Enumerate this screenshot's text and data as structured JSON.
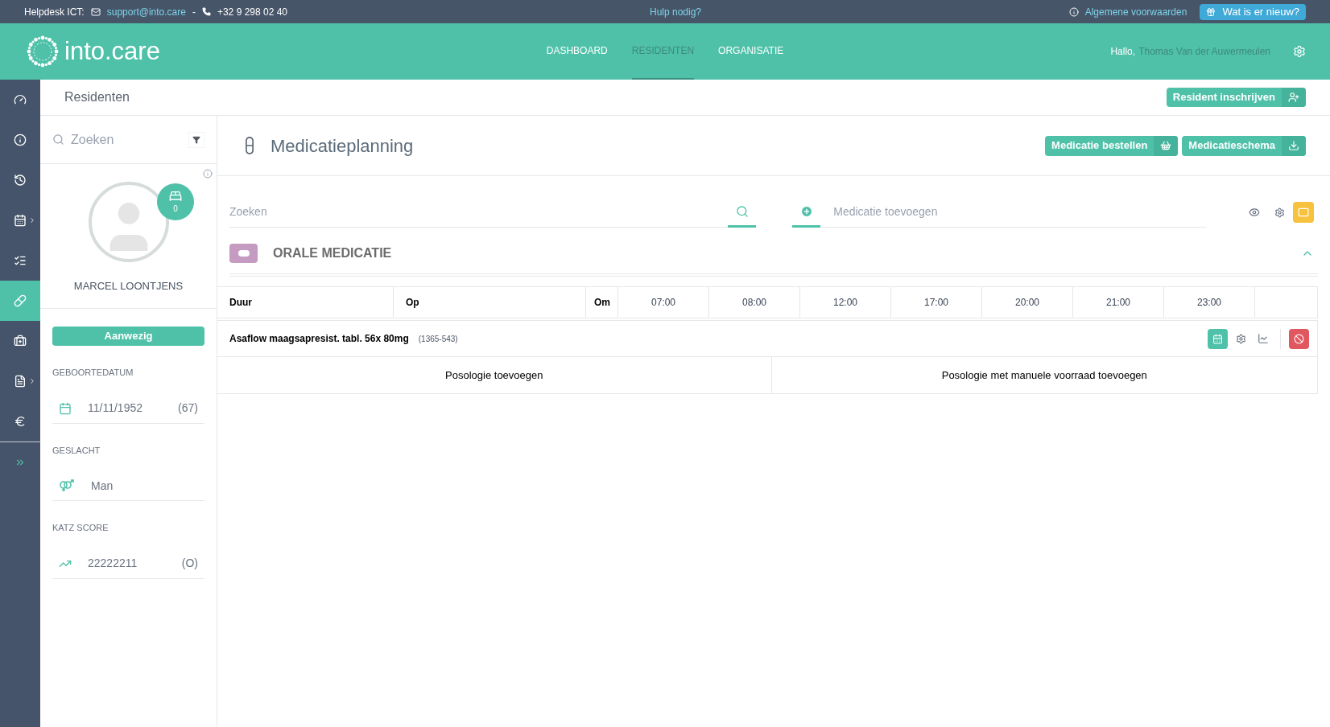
{
  "top_bar": {
    "helpdesk_label": "Helpdesk ICT:",
    "email": "support@into.care",
    "separator": "-",
    "phone": "+32 9 298 02 40",
    "help_link": "Hulp nodig?",
    "terms_link": "Algemene voorwaarden",
    "whats_new_button": "Wat is er nieuw?"
  },
  "nav": {
    "logo_text": "into.care",
    "items": [
      {
        "label": "DASHBOARD",
        "selected": false
      },
      {
        "label": "RESIDENTEN",
        "selected": true
      },
      {
        "label": "ORGANISATIE",
        "selected": false
      }
    ],
    "greeting": "Hallo,",
    "user_name": "Thomas Van der Auwermeulen"
  },
  "rail": {
    "items": [
      {
        "kind": "dashboard",
        "selected": false,
        "submenu": false
      },
      {
        "kind": "info",
        "selected": false,
        "submenu": false
      },
      {
        "kind": "history",
        "selected": false,
        "submenu": false
      },
      {
        "kind": "calendar",
        "selected": false,
        "submenu": true
      },
      {
        "kind": "checklist",
        "selected": false,
        "submenu": false
      },
      {
        "kind": "pill",
        "selected": true,
        "submenu": false
      },
      {
        "kind": "medkit",
        "selected": false,
        "submenu": false
      },
      {
        "kind": "document",
        "selected": false,
        "submenu": true
      },
      {
        "kind": "euro",
        "selected": false,
        "submenu": false
      }
    ]
  },
  "page_header": {
    "title": "Residenten",
    "enroll_button": "Resident inschrijven"
  },
  "resident": {
    "search_placeholder": "Zoeken",
    "bed_count": "0",
    "name": "MARCEL LOONTJENS",
    "status_button": "Aanwezig",
    "fields": [
      {
        "kind": "birthdate",
        "label": "GEBOORTEDATUM",
        "value": "11/11/1952",
        "extra": "(67)"
      },
      {
        "kind": "gender",
        "label": "GESLACHT",
        "value": "Man"
      },
      {
        "kind": "katz",
        "label": "KATZ SCORE",
        "value": "22222211",
        "extra": "(O)"
      }
    ]
  },
  "main": {
    "title": "Medicatieplanning",
    "buttons": [
      {
        "kind": "order",
        "label": "Medicatie bestellen"
      },
      {
        "kind": "download",
        "label": "Medicatieschema"
      }
    ],
    "search_placeholder": "Zoeken",
    "add_placeholder": "Medicatie toevoegen",
    "section": {
      "title": "ORALE MEDICATIE",
      "expanded": true
    },
    "columns": [
      "Duur",
      "Op",
      "Om",
      "07:00",
      "08:00",
      "12:00",
      "17:00",
      "20:00",
      "21:00",
      "23:00"
    ],
    "medication": {
      "name": "Asaflow maagsapresist. tabl. 56x 80mg",
      "code": "(1365-543)"
    },
    "posology_actions": [
      "Posologie toevoegen",
      "Posologie met manuele voorraad toevoegen"
    ]
  }
}
